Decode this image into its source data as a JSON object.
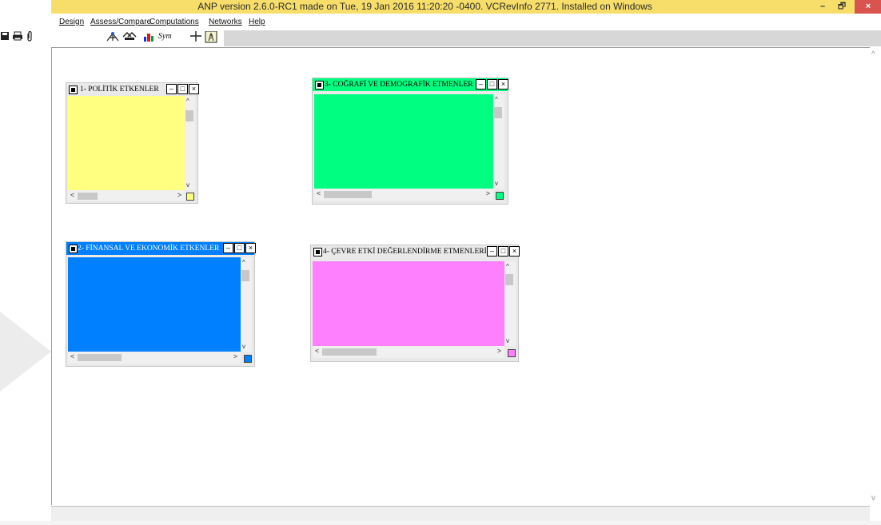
{
  "window": {
    "title": "ANP version 2.6.0-RC1 made on Tue, 19 Jan 2016 11:20:20 -0400.  VCRevInfo 2771.  Installed on Windows",
    "minimize": "–",
    "maximize": "🗗",
    "close": "×"
  },
  "menu": [
    {
      "label": "Design"
    },
    {
      "label": "Assess/Compare"
    },
    {
      "label": "Computations"
    },
    {
      "label": "Networks"
    },
    {
      "label": "Help"
    }
  ],
  "toolbar": {
    "save_icon": "floppy-icon",
    "print_icon": "printer-icon",
    "clip_icon": "paperclip-icon",
    "sym_label": "Sym"
  },
  "clusters": [
    {
      "title": "1- POLİTİK ETKENLER",
      "color": "#ffff80",
      "header_color": "#ffff80"
    },
    {
      "title": "3- COĞRAFİ VE DEMOGRAFİK ETMENLER",
      "color": "#00ff80",
      "header_color": "#00ff80"
    },
    {
      "title": "2- FİNANSAL VE EKONOMİK  ETKENLER",
      "color": "#0080ff",
      "header_color": "#0080ff"
    },
    {
      "title": "4- ÇEVRE ETKİ DEĞERLENDİRME ETMENLERİ",
      "color": "#ff80ff",
      "header_color": "#ff80ff"
    }
  ]
}
